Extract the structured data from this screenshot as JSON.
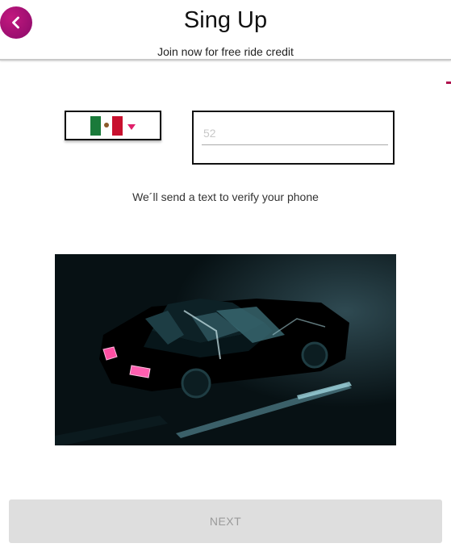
{
  "header": {
    "title": "Sing Up",
    "subtitle": "Join now for free ride credit",
    "back_icon": "chevron-left-icon"
  },
  "form": {
    "country": {
      "flag_icon": "mexico-flag-icon",
      "caret_icon": "caret-down-icon"
    },
    "phone": {
      "placeholder": "52",
      "value": ""
    },
    "verify_note": "We´ll send a text to verify your phone"
  },
  "hero_image": {
    "subject": "dark illustration of car with pink tail lights"
  },
  "actions": {
    "next_label": "NEXT"
  },
  "colors": {
    "accent": "#b0167a",
    "caret": "#e0206a",
    "disabled_bg": "#dedede",
    "disabled_text": "#9a9a9a"
  }
}
